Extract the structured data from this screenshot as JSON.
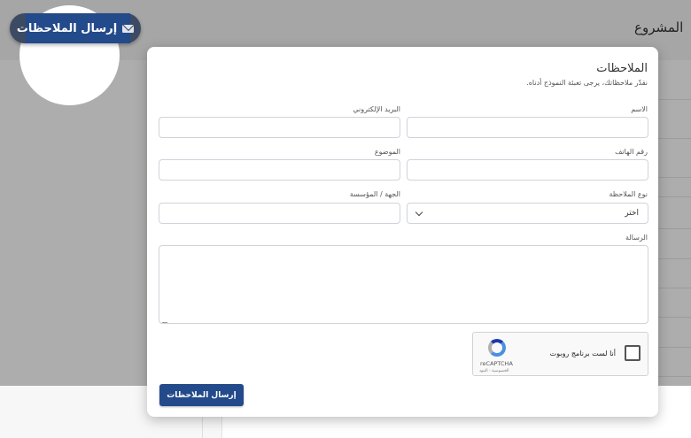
{
  "background": {
    "title": "المشروع"
  },
  "floating_button": {
    "label": "إرسال الملاحظات",
    "icon": "mail-icon"
  },
  "modal": {
    "title": "الملاحظات",
    "subtitle": "نقدّر ملاحظاتك، يرجى تعبئة النموذج أدناه.",
    "fields": {
      "name": {
        "label": "الاسم",
        "value": ""
      },
      "email": {
        "label": "البريد الإلكتروني",
        "value": ""
      },
      "phone": {
        "label": "رقم الهاتف",
        "value": ""
      },
      "subject": {
        "label": "الموضوع",
        "value": ""
      },
      "feedback_type": {
        "label": "نوع الملاحظة",
        "selected": "اختر"
      },
      "organization": {
        "label": "الجهة / المؤسسة",
        "value": ""
      },
      "message": {
        "label": "الرسالة",
        "value": ""
      }
    },
    "recaptcha": {
      "label": "أنا لست برنامج روبوت",
      "brand": "reCAPTCHA",
      "terms": "الخصوصية - البنود"
    },
    "submit_label": "إرسال الملاحظات"
  },
  "colors": {
    "primary": "#234a8a",
    "pill_background": "#3d4a63",
    "overlay": "rgba(0,0,0,0.32)"
  }
}
